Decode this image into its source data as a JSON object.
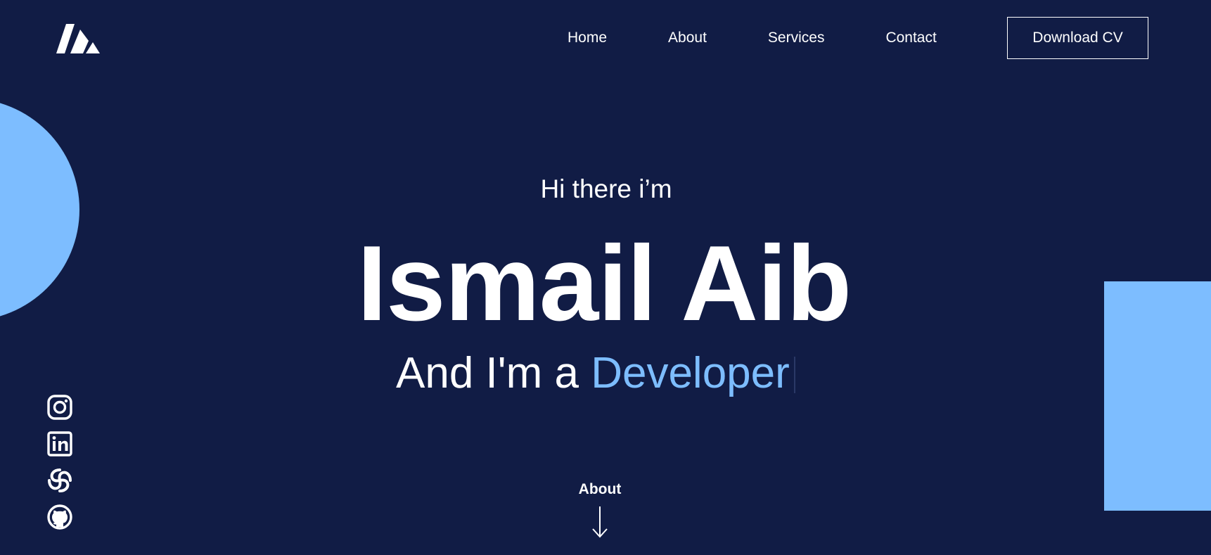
{
  "colors": {
    "background": "#111c45",
    "accent": "#7dbdff",
    "text": "#ffffff"
  },
  "header": {
    "logo_icon": "mountain-logo-icon",
    "nav": [
      {
        "label": "Home"
      },
      {
        "label": "About"
      },
      {
        "label": "Services"
      },
      {
        "label": "Contact"
      }
    ],
    "cta_label": "Download CV"
  },
  "hero": {
    "intro": "Hi there i’m",
    "name": "Ismail Aib",
    "role_prefix": "And I'm a ",
    "role_highlight": "Developer"
  },
  "socials": [
    {
      "icon": "instagram-icon"
    },
    {
      "icon": "linkedin-icon"
    },
    {
      "icon": "sourcerer-icon"
    },
    {
      "icon": "github-icon"
    }
  ],
  "scroll": {
    "label": "About",
    "icon": "arrow-down-icon"
  }
}
